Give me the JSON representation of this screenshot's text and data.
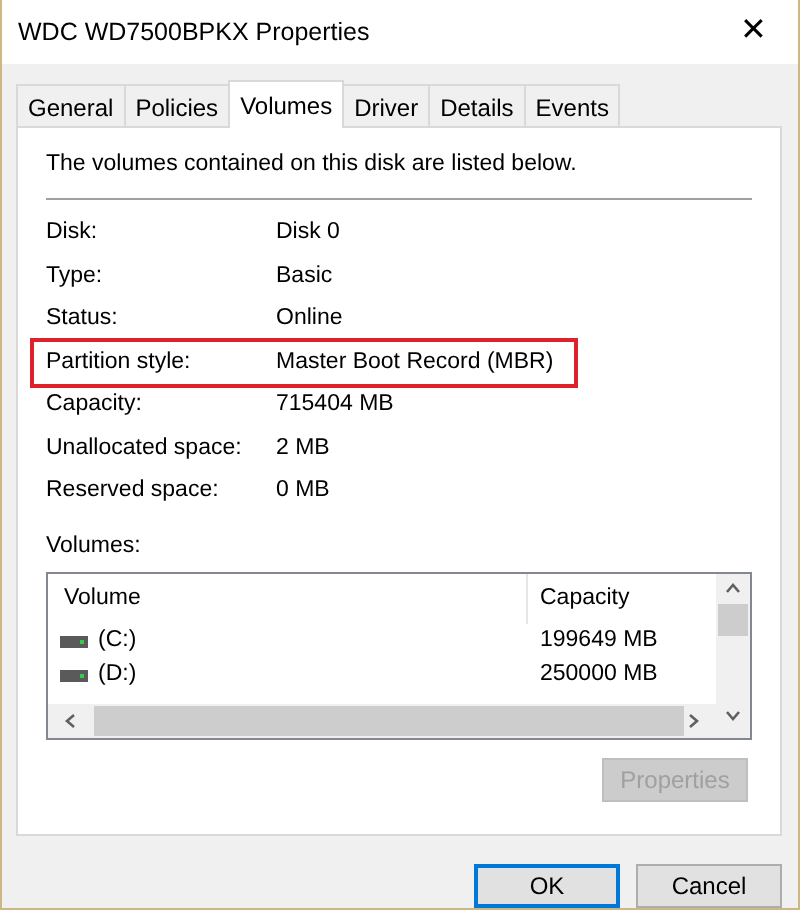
{
  "window": {
    "title": "WDC WD7500BPKX Properties",
    "close": "✕"
  },
  "tabs": [
    {
      "label": "General",
      "selected": false
    },
    {
      "label": "Policies",
      "selected": false
    },
    {
      "label": "Volumes",
      "selected": true
    },
    {
      "label": "Driver",
      "selected": false
    },
    {
      "label": "Details",
      "selected": false
    },
    {
      "label": "Events",
      "selected": false
    }
  ],
  "intro": "The volumes contained on this disk are listed below.",
  "properties": [
    {
      "label": "Disk:",
      "value": "Disk 0",
      "highlighted": false
    },
    {
      "label": "Type:",
      "value": "Basic",
      "highlighted": false
    },
    {
      "label": "Status:",
      "value": "Online",
      "highlighted": false
    },
    {
      "label": "Partition style:",
      "value": "Master Boot Record (MBR)",
      "highlighted": true
    },
    {
      "label": "Capacity:",
      "value": "715404 MB",
      "highlighted": false
    },
    {
      "label": "Unallocated space:",
      "value": "2 MB",
      "highlighted": false
    },
    {
      "label": "Reserved space:",
      "value": "0 MB",
      "highlighted": false
    }
  ],
  "volumes": {
    "label": "Volumes:",
    "columns": [
      "Volume",
      "Capacity"
    ],
    "rows": [
      {
        "volume": "(C:)",
        "capacity": "199649 MB"
      },
      {
        "volume": "(D:)",
        "capacity": "250000 MB"
      }
    ],
    "properties_button": {
      "label": "Properties",
      "disabled": true
    }
  },
  "buttons": [
    {
      "label": "OK",
      "default": true
    },
    {
      "label": "Cancel",
      "default": false
    }
  ]
}
